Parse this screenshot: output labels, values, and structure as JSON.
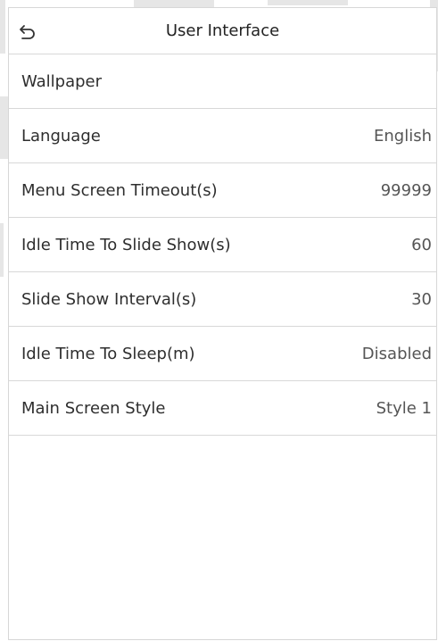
{
  "header": {
    "title": "User Interface",
    "back_icon": "back-arrow-icon"
  },
  "menu": {
    "items": [
      {
        "label": "Wallpaper",
        "value": ""
      },
      {
        "label": "Language",
        "value": "English"
      },
      {
        "label": "Menu Screen Timeout(s)",
        "value": "99999"
      },
      {
        "label": "Idle Time To Slide Show(s)",
        "value": "60"
      },
      {
        "label": "Slide Show Interval(s)",
        "value": "30"
      },
      {
        "label": "Idle Time To Sleep(m)",
        "value": "Disabled"
      },
      {
        "label": "Main Screen Style",
        "value": "Style 1"
      }
    ]
  },
  "colors": {
    "background": "#ffffff",
    "divider": "#d8d8d8",
    "text": "#2e2e2e",
    "value_text": "#555555"
  }
}
